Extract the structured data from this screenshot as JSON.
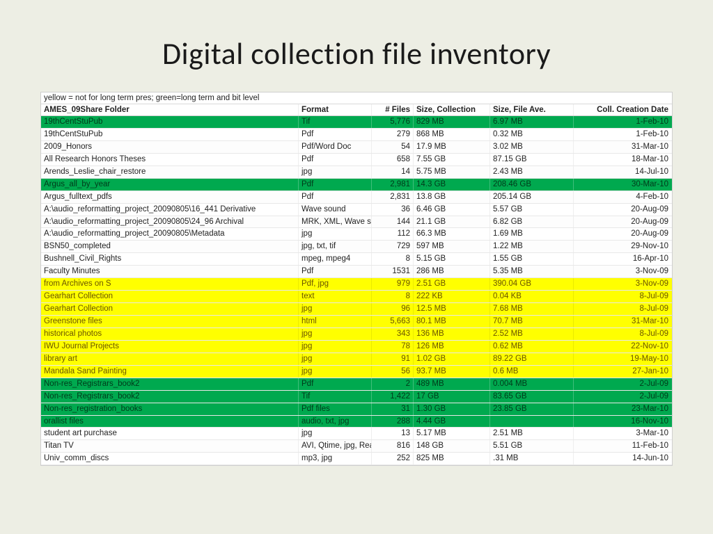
{
  "title": "Digital collection file inventory",
  "legend": "yellow = not for long term pres; green=long term and bit level",
  "headers": {
    "folder": "AMES_09Share Folder",
    "format": "Format",
    "files": "# Files",
    "sizeColl": "Size, Collection",
    "sizeAve": "Size, File Ave.",
    "date": "Coll. Creation Date"
  },
  "rows": [
    {
      "hl": "green",
      "folder": "19thCentStuPub",
      "format": "Tif",
      "files": "5,776",
      "sizeColl": "829 MB",
      "sizeAve": "6.97 MB",
      "date": "1-Feb-10"
    },
    {
      "hl": "plain",
      "folder": "19thCentStuPub",
      "format": "Pdf",
      "files": "279",
      "sizeColl": "868 MB",
      "sizeAve": "0.32 MB",
      "date": "1-Feb-10"
    },
    {
      "hl": "plain",
      "folder": "2009_Honors",
      "format": "Pdf/Word Doc",
      "files": "54",
      "sizeColl": "17.9 MB",
      "sizeAve": "3.02 MB",
      "date": "31-Mar-10"
    },
    {
      "hl": "plain",
      "folder": "All Research Honors Theses",
      "format": "Pdf",
      "files": "658",
      "sizeColl": "7.55 GB",
      "sizeAve": "87.15 GB",
      "date": "18-Mar-10"
    },
    {
      "hl": "plain",
      "folder": "Arends_Leslie_chair_restore",
      "format": "jpg",
      "files": "14",
      "sizeColl": "5.75 MB",
      "sizeAve": "2.43 MB",
      "date": "14-Jul-10"
    },
    {
      "hl": "green",
      "folder": "Argus_all_by_year",
      "format": "Pdf",
      "files": "2,981",
      "sizeColl": "14.3 GB",
      "sizeAve": "208.46 GB",
      "date": "30-Mar-10"
    },
    {
      "hl": "plain",
      "folder": "Argus_fulltext_pdfs",
      "format": "Pdf",
      "files": "2,831",
      "sizeColl": "13.8 GB",
      "sizeAve": "205.14 GB",
      "date": "4-Feb-10"
    },
    {
      "hl": "plain",
      "folder": "A:\\audio_reformatting_project_20090805\\16_441 Derivative",
      "format": "Wave sound",
      "files": "36",
      "sizeColl": "6.46 GB",
      "sizeAve": "5.57 GB",
      "date": "20-Aug-09"
    },
    {
      "hl": "plain",
      "folder": "A:\\audio_reformatting_project_20090805\\24_96 Archival",
      "format": "MRK, XML, Wave so",
      "files": "144",
      "sizeColl": "21.1 GB",
      "sizeAve": "6.82 GB",
      "date": "20-Aug-09"
    },
    {
      "hl": "plain",
      "folder": "A:\\audio_reformatting_project_20090805\\Metadata",
      "format": "jpg",
      "files": "112",
      "sizeColl": "66.3 MB",
      "sizeAve": "1.69 MB",
      "date": "20-Aug-09"
    },
    {
      "hl": "plain",
      "folder": "BSN50_completed",
      "format": "jpg, txt, tif",
      "files": "729",
      "sizeColl": "597 MB",
      "sizeAve": "1.22 MB",
      "date": "29-Nov-10"
    },
    {
      "hl": "plain",
      "folder": "Bushnell_Civil_Rights",
      "format": "mpeg, mpeg4",
      "files": "8",
      "sizeColl": "5.15 GB",
      "sizeAve": "1.55 GB",
      "date": "16-Apr-10"
    },
    {
      "hl": "plain",
      "folder": "Faculty Minutes",
      "format": "Pdf",
      "files": "1531",
      "sizeColl": "286 MB",
      "sizeAve": "5.35 MB",
      "date": "3-Nov-09"
    },
    {
      "hl": "yellow",
      "folder": "from Archives on S",
      "format": "Pdf, jpg",
      "files": "979",
      "sizeColl": "2.51 GB",
      "sizeAve": "390.04 GB",
      "date": "3-Nov-09"
    },
    {
      "hl": "yellow",
      "folder": "Gearhart Collection",
      "format": "text",
      "files": "8",
      "sizeColl": "222 KB",
      "sizeAve": "0.04 KB",
      "date": "8-Jul-09"
    },
    {
      "hl": "yellow",
      "folder": "Gearhart Collection",
      "format": "jpg",
      "files": "96",
      "sizeColl": "12.5 MB",
      "sizeAve": "7.68 MB",
      "date": "8-Jul-09"
    },
    {
      "hl": "yellow",
      "folder": "Greenstone files",
      "format": "html",
      "files": "5,663",
      "sizeColl": "80.1 MB",
      "sizeAve": "70.7 MB",
      "date": "31-Mar-10"
    },
    {
      "hl": "yellow",
      "folder": "historical photos",
      "format": "jpg",
      "files": "343",
      "sizeColl": "136 MB",
      "sizeAve": "2.52 MB",
      "date": "8-Jul-09"
    },
    {
      "hl": "yellow",
      "folder": "IWU Journal Projects",
      "format": "jpg",
      "files": "78",
      "sizeColl": "126 MB",
      "sizeAve": "0.62 MB",
      "date": "22-Nov-10"
    },
    {
      "hl": "yellow",
      "folder": "library art",
      "format": "jpg",
      "files": "91",
      "sizeColl": "1.02 GB",
      "sizeAve": "89.22 GB",
      "date": "19-May-10"
    },
    {
      "hl": "yellow",
      "folder": "Mandala Sand Painting",
      "format": "jpg",
      "files": "56",
      "sizeColl": "93.7 MB",
      "sizeAve": "0.6 MB",
      "date": "27-Jan-10"
    },
    {
      "hl": "green",
      "folder": "Non-res_Registrars_book2",
      "format": "Pdf",
      "files": "2",
      "sizeColl": "489 MB",
      "sizeAve": "0.004 MB",
      "date": "2-Jul-09"
    },
    {
      "hl": "green",
      "folder": "Non-res_Registrars_book2",
      "format": "Tif",
      "files": "1,422",
      "sizeColl": "17 GB",
      "sizeAve": "83.65 GB",
      "date": "2-Jul-09"
    },
    {
      "hl": "green",
      "folder": "Non-res_registration_books",
      "format": "Pdf files",
      "files": "31",
      "sizeColl": "1.30 GB",
      "sizeAve": "23.85 GB",
      "date": "23-Mar-10"
    },
    {
      "hl": "green",
      "folder": "orallist files",
      "format": "audio, txt, jpg",
      "files": "288",
      "sizeColl": "4.44 GB",
      "sizeAve": "",
      "date": "16-Nov-10"
    },
    {
      "hl": "plain",
      "folder": "student art purchase",
      "format": "jpg",
      "files": "13",
      "sizeColl": "5.17 MB",
      "sizeAve": "2.51 MB",
      "date": "3-Mar-10"
    },
    {
      "hl": "plain",
      "folder": "Titan TV",
      "format": "AVI, Qtime, jpg, Rea",
      "files": "816",
      "sizeColl": "148 GB",
      "sizeAve": "5.51 GB",
      "date": "11-Feb-10"
    },
    {
      "hl": "plain",
      "folder": "Univ_comm_discs",
      "format": "mp3, jpg",
      "files": "252",
      "sizeColl": "825 MB",
      "sizeAve": ".31 MB",
      "date": "14-Jun-10"
    }
  ]
}
